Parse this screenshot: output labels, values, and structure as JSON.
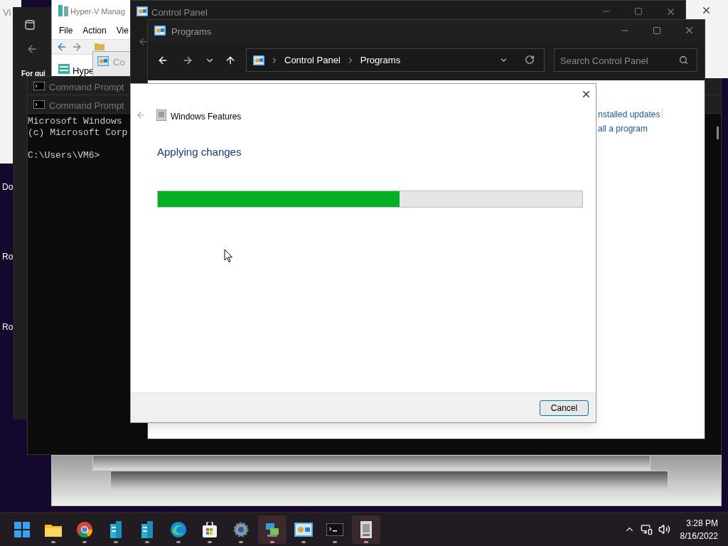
{
  "background_window": {
    "title": "Vi"
  },
  "desktop_icons": [
    {
      "label": "Do"
    },
    {
      "label": "Ro"
    },
    {
      "label": "Ro"
    }
  ],
  "settings_window": {
    "heading": "For qui"
  },
  "hyperv_window": {
    "title": "Hyper-V Manag",
    "menu": [
      "File",
      "Action",
      "Vie"
    ],
    "tree_item": "Hype"
  },
  "small_window": {
    "title": "Co"
  },
  "command_prompts": [
    {
      "title": "Command Prompt"
    },
    {
      "title": "Command Prompt"
    }
  ],
  "console": {
    "lines": [
      "Microsoft Windows",
      "(c) Microsoft Corp"
    ],
    "prompt": "C:\\Users\\VM6>"
  },
  "control_panel_window": {
    "title": "Control Panel"
  },
  "programs_window": {
    "title": "Programs",
    "address": [
      "Control Panel",
      "Programs"
    ],
    "search": {
      "placeholder": "Search Control Panel"
    },
    "links": [
      "nstalled updates",
      "all a program"
    ]
  },
  "dialog": {
    "title": "Windows Features",
    "heading": "Applying changes",
    "progress": {
      "level": 0.57
    },
    "cancel": "Cancel"
  },
  "taskbar": {
    "apps": [
      {
        "kind": "start",
        "active": false,
        "running": false
      },
      {
        "kind": "folder",
        "active": false,
        "running": true
      },
      {
        "kind": "chrome",
        "active": false,
        "running": true
      },
      {
        "kind": "server",
        "active": false,
        "running": true
      },
      {
        "kind": "server2",
        "active": false,
        "running": true
      },
      {
        "kind": "edge",
        "active": false,
        "running": true
      },
      {
        "kind": "store",
        "active": false,
        "running": true
      },
      {
        "kind": "gear",
        "active": false,
        "running": true
      },
      {
        "kind": "servermgr",
        "active": true,
        "running": true
      },
      {
        "kind": "controlpanel",
        "active": false,
        "running": true
      },
      {
        "kind": "terminal",
        "active": false,
        "running": true
      },
      {
        "kind": "features",
        "active": true,
        "running": true
      }
    ],
    "time": "3:28 PM",
    "date": "8/16/2022"
  }
}
